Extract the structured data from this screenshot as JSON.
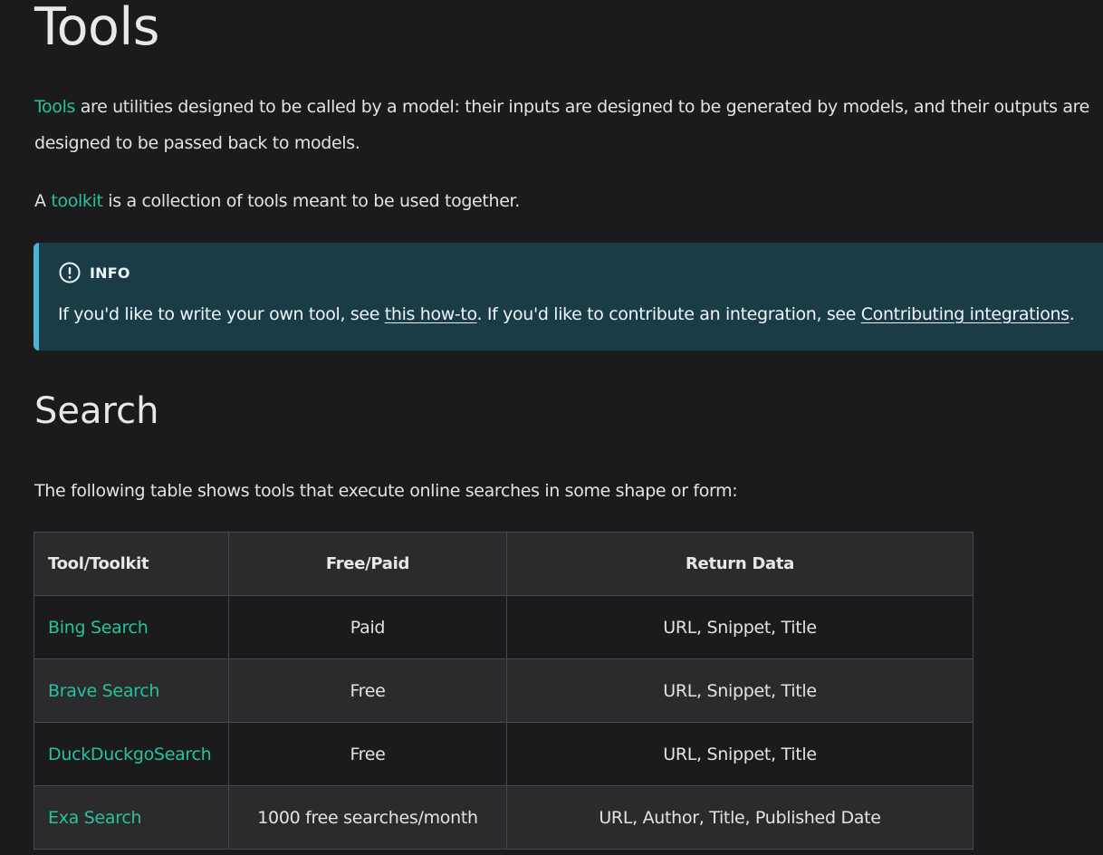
{
  "page": {
    "title": "Tools",
    "intro": {
      "link_text": "Tools",
      "rest": " are utilities designed to be called by a model: their inputs are designed to be generated by models, and their outputs are designed to be passed back to models."
    },
    "toolkit": {
      "prefix": "A ",
      "link_text": "toolkit",
      "rest": " is a collection of tools meant to be used together."
    },
    "info": {
      "title": "INFO",
      "icon": "exclamation-circle-icon",
      "text_1": "If you'd like to write your own tool, see ",
      "link_1": "this how-to",
      "text_2": ". If you'd like to contribute an integration, see ",
      "link_2": "Contributing integrations",
      "text_3": "."
    },
    "search": {
      "heading": "Search",
      "description": "The following table shows tools that execute online searches in some shape or form:",
      "table": {
        "headers": [
          "Tool/Toolkit",
          "Free/Paid",
          "Return Data"
        ],
        "rows": [
          [
            "Bing Search",
            "Paid",
            "URL, Snippet, Title"
          ],
          [
            "Brave Search",
            "Free",
            "URL, Snippet, Title"
          ],
          [
            "DuckDuckgoSearch",
            "Free",
            "URL, Snippet, Title"
          ],
          [
            "Exa Search",
            "1000 free searches/month",
            "URL, Author, Title, Published Date"
          ]
        ]
      }
    }
  },
  "colors": {
    "background": "#1b1b1d",
    "link": "#25c2a0",
    "info_bg": "#193c47",
    "info_border": "#4cb3d4"
  }
}
